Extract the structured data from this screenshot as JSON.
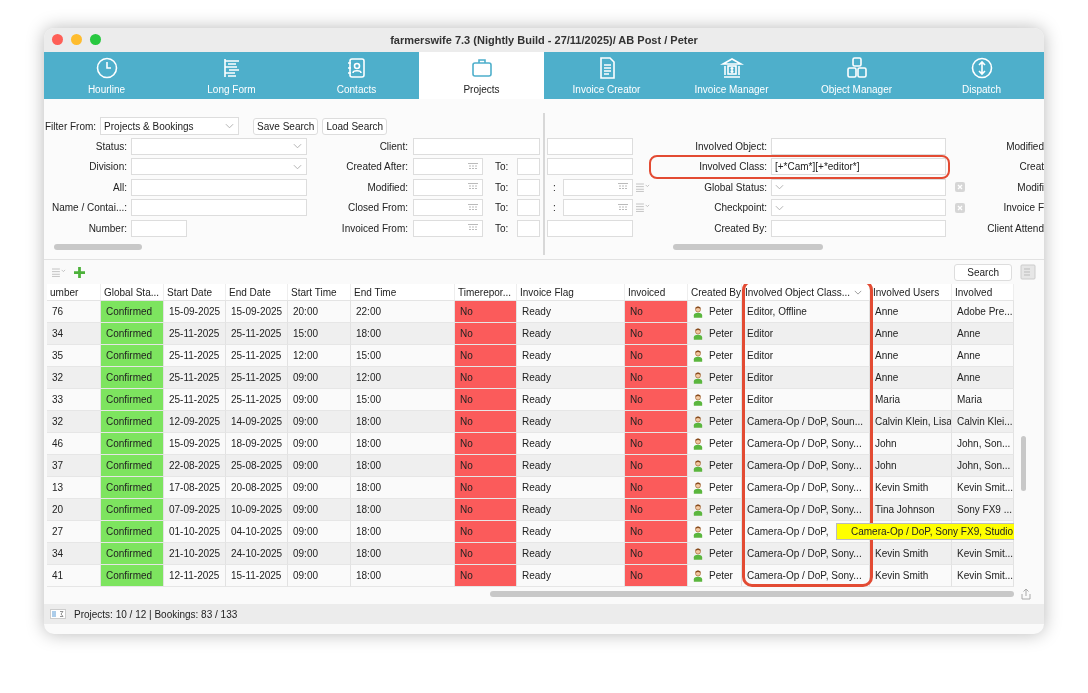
{
  "window": {
    "title": "farmerswife 7.3  (Nightly Build - 27/11/2025)/ AB Post / Peter"
  },
  "tabs": [
    {
      "label": "Hourline",
      "selected": false
    },
    {
      "label": "Long Form",
      "selected": false
    },
    {
      "label": "Contacts",
      "selected": false
    },
    {
      "label": "Projects",
      "selected": true
    },
    {
      "label": "Invoice Creator",
      "selected": false
    },
    {
      "label": "Invoice Manager",
      "selected": false
    },
    {
      "label": "Object Manager",
      "selected": false
    },
    {
      "label": "Dispatch",
      "selected": false
    }
  ],
  "filter": {
    "filter_from": {
      "label": "Filter From:",
      "value": "Projects & Bookings"
    },
    "buttons": [
      "Save Search",
      "Load Search"
    ],
    "left_rows": [
      {
        "label": "Status:",
        "kind": "select"
      },
      {
        "label": "Division:",
        "kind": "select"
      },
      {
        "label": "All:",
        "kind": "text"
      },
      {
        "label": "Name / Contai...:",
        "kind": "text"
      },
      {
        "label": "Number:",
        "kind": "short"
      }
    ],
    "middle_rows": [
      {
        "label": "Client:",
        "kind": "text"
      },
      {
        "label": "Created After:",
        "kind": "date",
        "to": "To:"
      },
      {
        "label": "Modified:",
        "kind": "date",
        "to": "To:"
      },
      {
        "label": "Closed From:",
        "kind": "date",
        "to": "To:"
      },
      {
        "label": "Invoiced From:",
        "kind": "date",
        "to": "To:"
      }
    ],
    "fragment_rows": [
      {
        "kind": "text"
      },
      {
        "kind": "text"
      },
      {
        "kind": "date",
        "label": ":"
      },
      {
        "kind": "date",
        "label": ":"
      },
      {
        "kind": "text"
      }
    ],
    "object_rows": [
      {
        "label": "Involved Object:",
        "kind": "text",
        "highlighted": false
      },
      {
        "label": "Involved Class:",
        "kind": "text",
        "value": "[+*Cam*][+*editor*]",
        "highlighted": true
      },
      {
        "label": "Global Status:",
        "kind": "select",
        "highlighted": false
      },
      {
        "label": "Checkpoint:",
        "kind": "select",
        "highlighted": false
      },
      {
        "label": "Created By:",
        "kind": "text",
        "highlighted": false
      }
    ],
    "far_labels": [
      "Modified",
      "Creat",
      "Modifi",
      "Invoice F",
      "Client Attend"
    ]
  },
  "table": {
    "search_button": "Search",
    "columns": [
      {
        "label": "umber",
        "kind": "text"
      },
      {
        "label": "Global Sta...",
        "kind": "confirmed"
      },
      {
        "label": "Start Date",
        "kind": "text"
      },
      {
        "label": "End Date",
        "kind": "text"
      },
      {
        "label": "Start Time",
        "kind": "text"
      },
      {
        "label": "End Time",
        "kind": "text"
      },
      {
        "label": "Timerepor...",
        "kind": "timereported"
      },
      {
        "label": "Invoice Flag",
        "kind": "text"
      },
      {
        "label": "Invoiced",
        "kind": "invoiced"
      },
      {
        "label": "Created By",
        "kind": "user"
      },
      {
        "label": "Involved Object Class...",
        "kind": "text",
        "sorted": true,
        "highlighted": true
      },
      {
        "label": "Involved Users",
        "kind": "text"
      },
      {
        "label": "Involved",
        "kind": "text"
      }
    ],
    "rows": [
      {
        "cells": [
          "76",
          "Confirmed",
          "15-09-2025",
          "15-09-2025",
          "20:00",
          "22:00",
          "No",
          "Ready",
          "No",
          "Peter",
          "Editor, Offline",
          "Anne",
          "Adobe Pre..."
        ],
        "confirmed": true,
        "timereported": false,
        "invoiced": false
      },
      {
        "cells": [
          "34",
          "Confirmed",
          "25-11-2025",
          "25-11-2025",
          "15:00",
          "18:00",
          "No",
          "Ready",
          "No",
          "Peter",
          "Editor",
          "Anne",
          "Anne"
        ],
        "confirmed": true,
        "timereported": false,
        "invoiced": false
      },
      {
        "cells": [
          "35",
          "Confirmed",
          "25-11-2025",
          "25-11-2025",
          "12:00",
          "15:00",
          "No",
          "Ready",
          "No",
          "Peter",
          "Editor",
          "Anne",
          "Anne"
        ],
        "confirmed": true,
        "timereported": false,
        "invoiced": false
      },
      {
        "cells": [
          "32",
          "Confirmed",
          "25-11-2025",
          "25-11-2025",
          "09:00",
          "12:00",
          "No",
          "Ready",
          "No",
          "Peter",
          "Editor",
          "Anne",
          "Anne"
        ],
        "confirmed": true,
        "timereported": false,
        "invoiced": false
      },
      {
        "cells": [
          "33",
          "Confirmed",
          "25-11-2025",
          "25-11-2025",
          "09:00",
          "15:00",
          "No",
          "Ready",
          "No",
          "Peter",
          "Editor",
          "Maria",
          "Maria"
        ],
        "confirmed": true,
        "timereported": false,
        "invoiced": false
      },
      {
        "cells": [
          "32",
          "Confirmed",
          "12-09-2025",
          "14-09-2025",
          "09:00",
          "18:00",
          "No",
          "Ready",
          "No",
          "Peter",
          "Camera-Op / DoP, Soun...",
          "Calvin Klein, Lisa",
          "Calvin Klei..."
        ],
        "confirmed": true,
        "timereported": false,
        "invoiced": false
      },
      {
        "cells": [
          "46",
          "Confirmed",
          "15-09-2025",
          "18-09-2025",
          "09:00",
          "18:00",
          "No",
          "Ready",
          "No",
          "Peter",
          "Camera-Op / DoP, Sony...",
          "John",
          "John, Son..."
        ],
        "confirmed": true,
        "timereported": false,
        "invoiced": false
      },
      {
        "cells": [
          "37",
          "Confirmed",
          "22-08-2025",
          "25-08-2025",
          "09:00",
          "18:00",
          "No",
          "Ready",
          "No",
          "Peter",
          "Camera-Op / DoP, Sony...",
          "John",
          "John, Son..."
        ],
        "confirmed": true,
        "timereported": false,
        "invoiced": false
      },
      {
        "cells": [
          "13",
          "Confirmed",
          "17-08-2025",
          "20-08-2025",
          "09:00",
          "18:00",
          "No",
          "Ready",
          "No",
          "Peter",
          "Camera-Op / DoP, Sony...",
          "Kevin Smith",
          "Kevin Smit..."
        ],
        "confirmed": true,
        "timereported": false,
        "invoiced": false
      },
      {
        "cells": [
          "20",
          "Confirmed",
          "07-09-2025",
          "10-09-2025",
          "09:00",
          "18:00",
          "No",
          "Ready",
          "No",
          "Peter",
          "Camera-Op / DoP, Sony...",
          "Tina Johnson",
          "Sony FX9 ..."
        ],
        "confirmed": true,
        "timereported": false,
        "invoiced": false
      },
      {
        "cells": [
          "27",
          "Confirmed",
          "01-10-2025",
          "04-10-2025",
          "09:00",
          "18:00",
          "No",
          "Ready",
          "No",
          "Peter",
          "Camera-Op / DoP,",
          null,
          null
        ],
        "confirmed": true,
        "timereported": false,
        "invoiced": false
      },
      {
        "cells": [
          "34",
          "Confirmed",
          "21-10-2025",
          "24-10-2025",
          "09:00",
          "18:00",
          "No",
          "Ready",
          "No",
          "Peter",
          "Camera-Op / DoP, Sony...",
          "Kevin Smith",
          "Kevin Smit..."
        ],
        "confirmed": true,
        "timereported": false,
        "invoiced": false
      },
      {
        "cells": [
          "41",
          "Confirmed",
          "12-11-2025",
          "15-11-2025",
          "09:00",
          "18:00",
          "No",
          "Ready",
          "No",
          "Peter",
          "Camera-Op / DoP, Sony...",
          "Kevin Smith",
          "Kevin Smit..."
        ],
        "confirmed": true,
        "timereported": false,
        "invoiced": false
      }
    ],
    "tooltip": {
      "text": "Camera-Op / DoP, Sony FX9, Studio"
    }
  },
  "status_bar": {
    "text": "Projects: 10 / 12 | Bookings: 83 / 133"
  }
}
